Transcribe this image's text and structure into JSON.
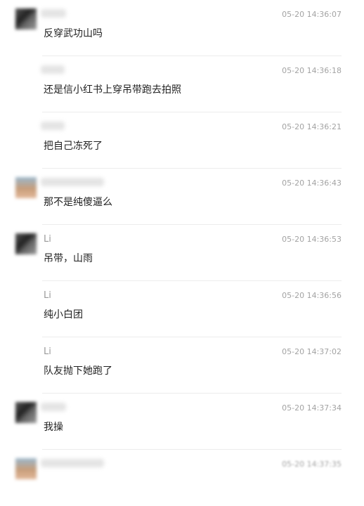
{
  "messages": [
    {
      "name": "",
      "avatar": "blurred-avatar",
      "time": "05-20 14:36:07",
      "text": "反穿武功山吗"
    },
    {
      "name": "",
      "avatar": "",
      "time": "05-20 14:36:18",
      "text": "还是信小红书上穿吊带跑去拍照"
    },
    {
      "name": "",
      "avatar": "",
      "time": "05-20 14:36:21",
      "text": "把自己冻死了"
    },
    {
      "name": "",
      "avatar": "blurred-avatar",
      "time": "05-20 14:36:43",
      "text": "那不是纯傻逼么"
    },
    {
      "name": "Li",
      "avatar": "blurred-avatar",
      "time": "05-20 14:36:53",
      "text": "吊带，山雨"
    },
    {
      "name": "Li",
      "avatar": "",
      "time": "05-20 14:36:56",
      "text": "纯小白团"
    },
    {
      "name": "Li",
      "avatar": "",
      "time": "05-20 14:37:02",
      "text": "队友抛下她跑了"
    },
    {
      "name": "",
      "avatar": "blurred-avatar",
      "time": "05-20 14:37:34",
      "text": "我操"
    },
    {
      "name": "",
      "avatar": "blurred-avatar",
      "time": "05-20 14:37:35",
      "text": ""
    }
  ]
}
